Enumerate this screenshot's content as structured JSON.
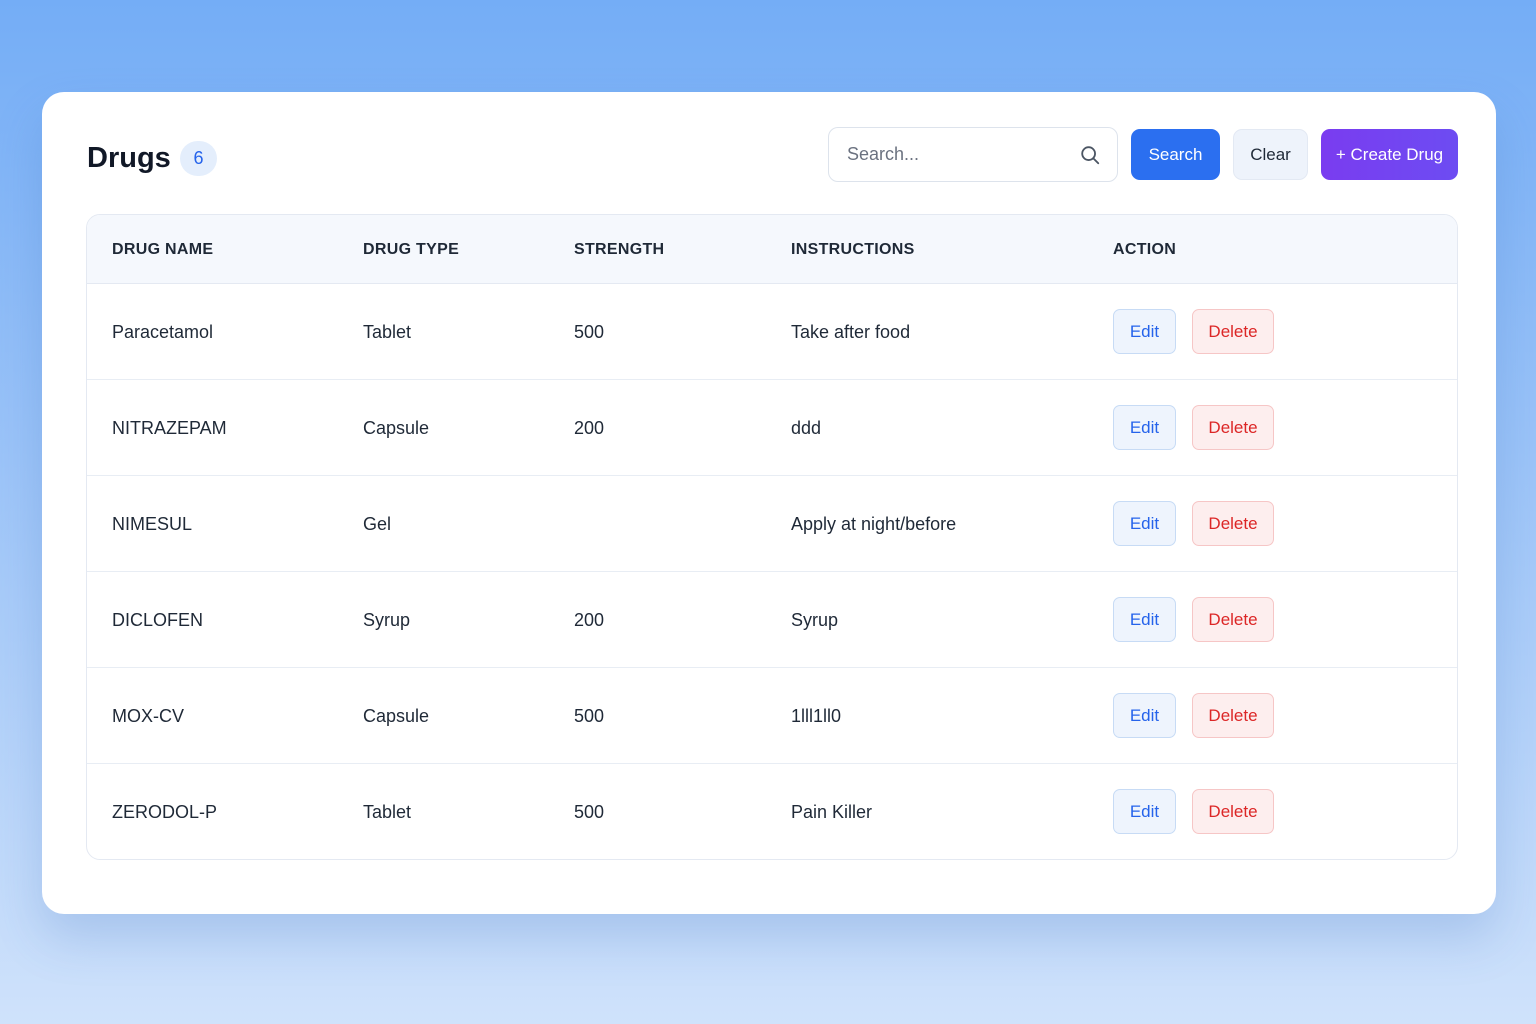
{
  "header": {
    "title": "Drugs",
    "count": "6",
    "search_placeholder": "Search...",
    "search_value": "",
    "search_button": "Search",
    "clear_button": "Clear",
    "create_button": "+ Create Drug"
  },
  "table": {
    "columns": [
      "DRUG NAME",
      "DRUG TYPE",
      "STRENGTH",
      "INSTRUCTIONS",
      "ACTION"
    ],
    "rows": [
      {
        "name": "Paracetamol",
        "type": "Tablet",
        "strength": "500",
        "instructions": "Take after food"
      },
      {
        "name": "NITRAZEPAM",
        "type": "Capsule",
        "strength": "200",
        "instructions": "ddd"
      },
      {
        "name": "NIMESUL",
        "type": "Gel",
        "strength": "",
        "instructions": "Apply at night/before"
      },
      {
        "name": "DICLOFEN",
        "type": "Syrup",
        "strength": "200",
        "instructions": "Syrup"
      },
      {
        "name": "MOX-CV",
        "type": "Capsule",
        "strength": "500",
        "instructions": "1lll1ll0"
      },
      {
        "name": "ZERODOL-P",
        "type": "Tablet",
        "strength": "500",
        "instructions": "Pain Killer"
      }
    ],
    "edit_label": "Edit",
    "delete_label": "Delete"
  },
  "icons": {
    "search": "search-icon"
  },
  "colors": {
    "primary": "#2b6ff0",
    "create": "#7a3cf0",
    "edit_text": "#2563eb",
    "delete_text": "#dc2626"
  }
}
